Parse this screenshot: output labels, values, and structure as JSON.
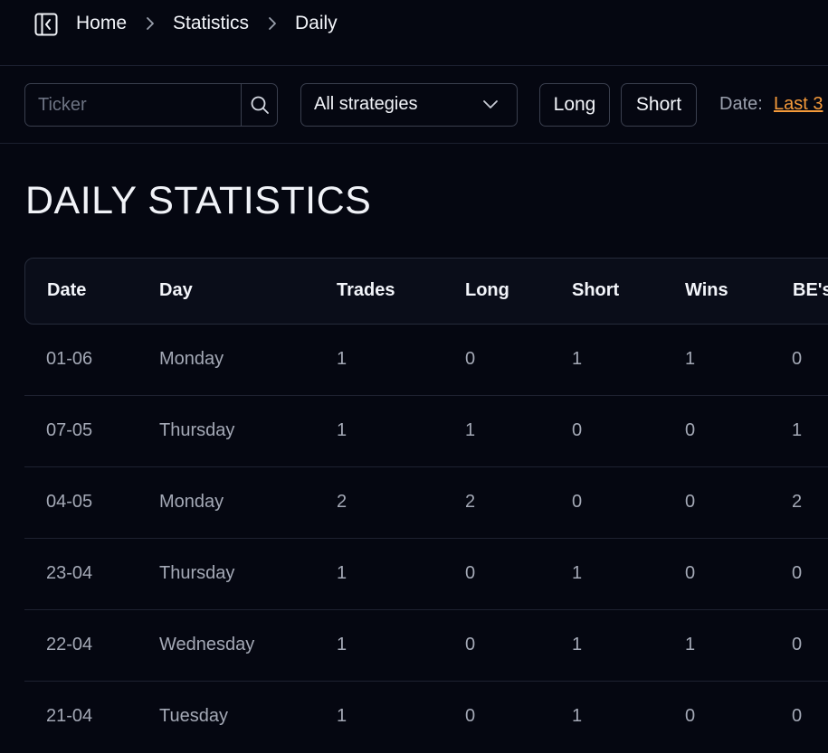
{
  "breadcrumb": {
    "items": [
      "Home",
      "Statistics",
      "Daily"
    ]
  },
  "filters": {
    "ticker_placeholder": "Ticker",
    "strategy_selected": "All strategies",
    "long_label": "Long",
    "short_label": "Short",
    "date_label": "Date:",
    "date_value": "Last 3"
  },
  "page": {
    "title": "DAILY STATISTICS"
  },
  "table": {
    "columns": [
      "Date",
      "Day",
      "Trades",
      "Long",
      "Short",
      "Wins",
      "BE's"
    ],
    "rows": [
      [
        "01-06",
        "Monday",
        "1",
        "0",
        "1",
        "1",
        "0"
      ],
      [
        "07-05",
        "Thursday",
        "1",
        "1",
        "0",
        "0",
        "1"
      ],
      [
        "04-05",
        "Monday",
        "2",
        "2",
        "0",
        "0",
        "2"
      ],
      [
        "23-04",
        "Thursday",
        "1",
        "0",
        "1",
        "0",
        "0"
      ],
      [
        "22-04",
        "Wednesday",
        "1",
        "0",
        "1",
        "1",
        "0"
      ],
      [
        "21-04",
        "Tuesday",
        "1",
        "0",
        "1",
        "0",
        "0"
      ]
    ]
  },
  "colors": {
    "background": "#050711",
    "accent_link": "#f59a3a",
    "border": "#3a3f4e"
  },
  "icons": {
    "sidebar_toggle": "sidebar-collapse-icon",
    "breadcrumb_separator": "chevron-right-icon",
    "search": "search-icon",
    "dropdown": "chevron-down-icon"
  }
}
